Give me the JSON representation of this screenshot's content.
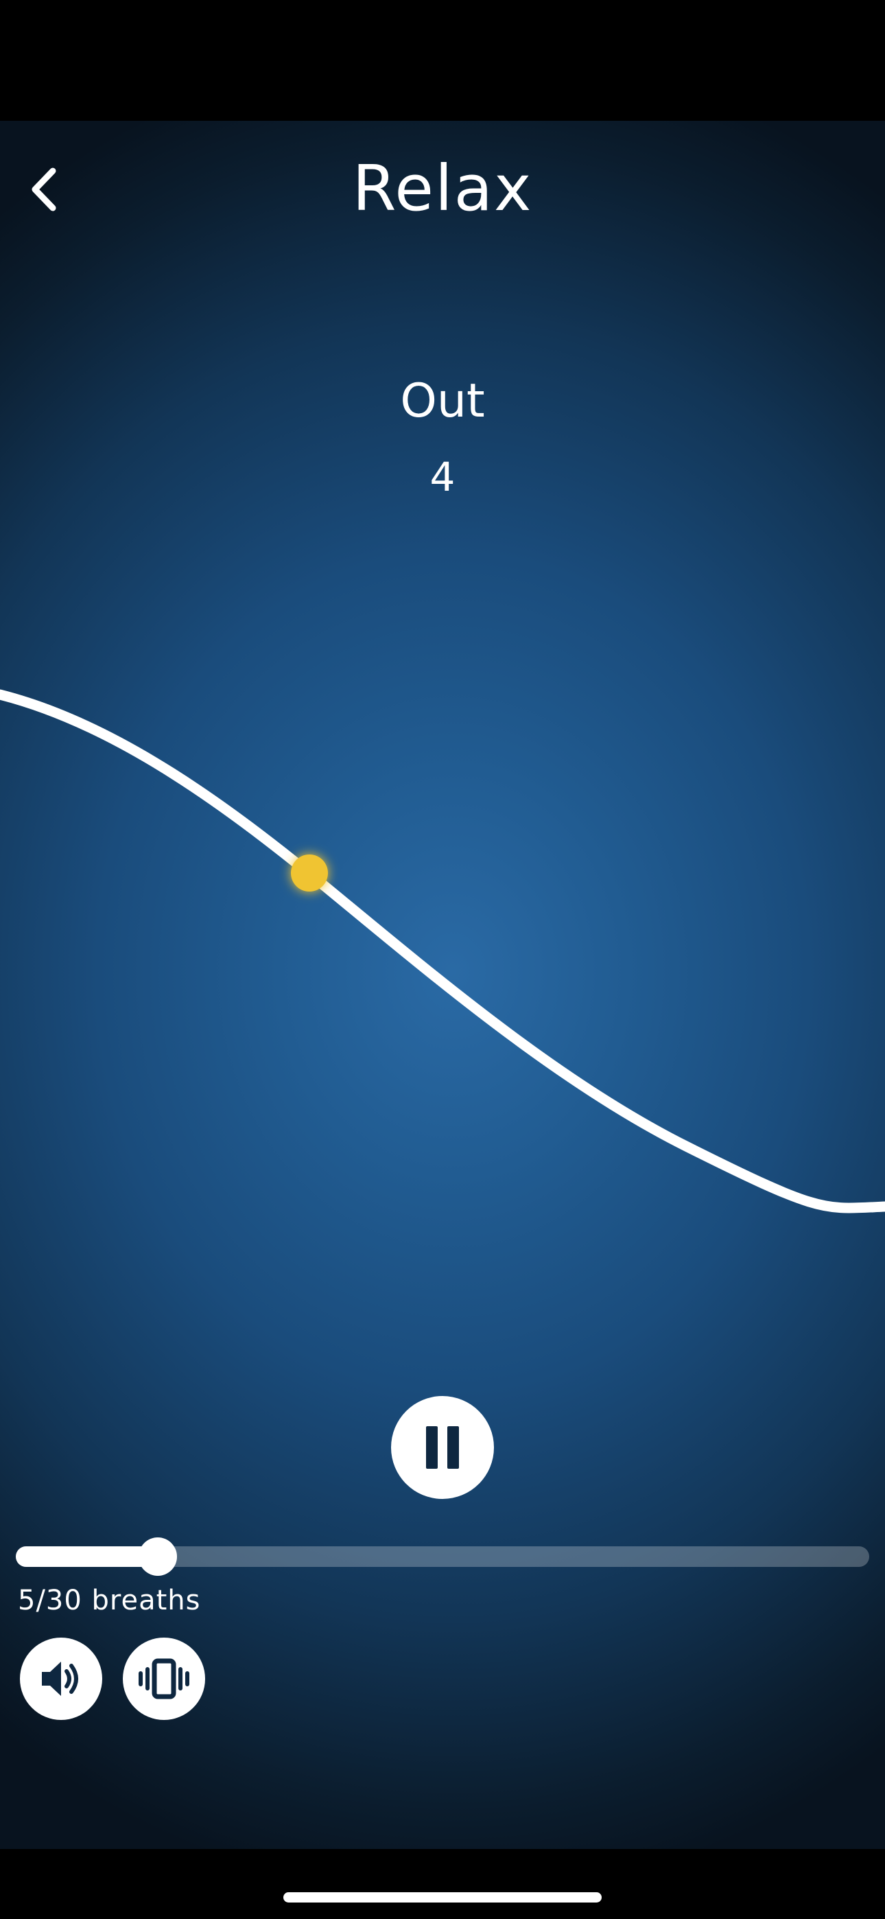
{
  "header": {
    "title": "Relax",
    "back_icon": "chevron-left-icon"
  },
  "breathing": {
    "phase": "Out",
    "count": "4"
  },
  "controls": {
    "pause_icon": "pause-icon",
    "sound_icon": "speaker-icon",
    "haptic_icon": "vibrate-icon"
  },
  "progress": {
    "completed": 5,
    "total": 30,
    "label": "5/30 breaths"
  },
  "colors": {
    "accent_dot": "#f0c430",
    "background_center": "#2a6aa5",
    "background_edge": "#08131f",
    "foreground": "#ffffff"
  }
}
